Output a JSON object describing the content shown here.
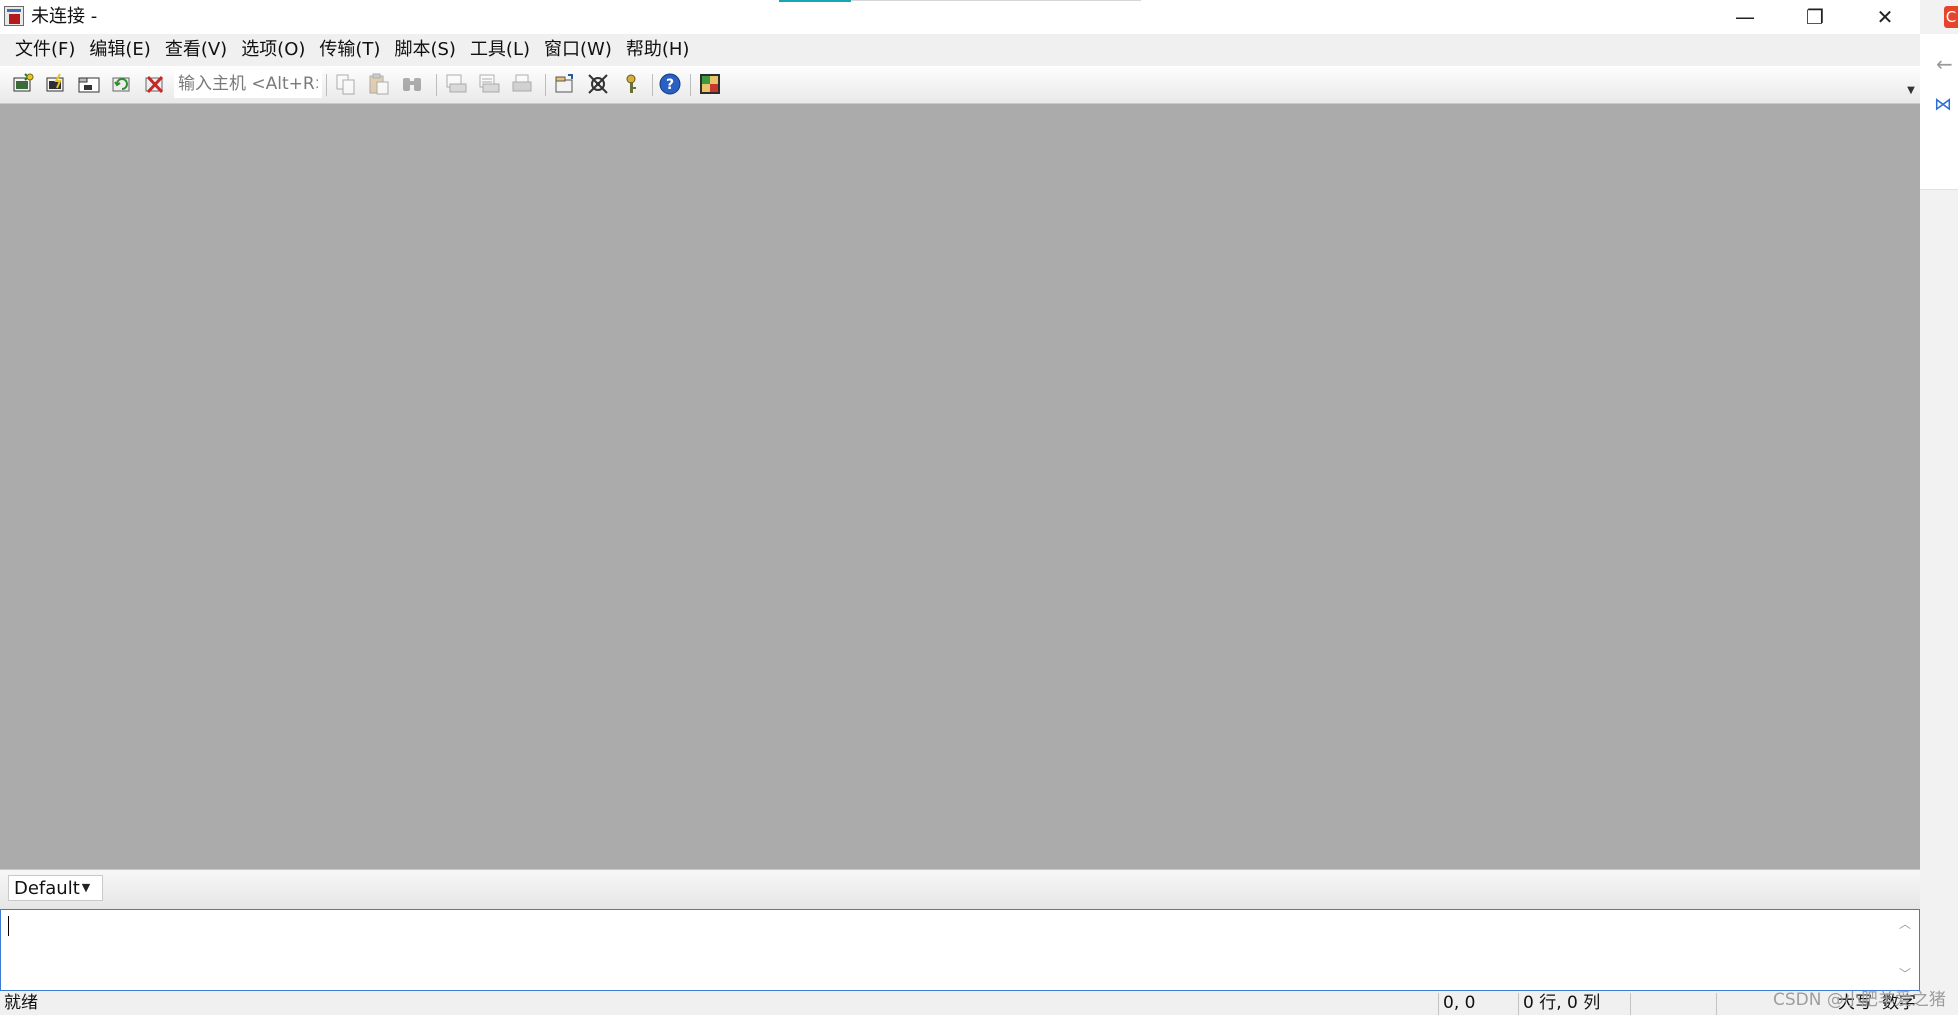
{
  "window": {
    "title": "未连接 -",
    "controls": {
      "minimize": "—",
      "maximize": "❐",
      "close": "✕"
    }
  },
  "menu": [
    "文件(F)",
    "编辑(E)",
    "查看(V)",
    "选项(O)",
    "传输(T)",
    "脚本(S)",
    "工具(L)",
    "窗口(W)",
    "帮助(H)"
  ],
  "toolbar": {
    "host_placeholder": "输入主机 <Alt+R>",
    "icons": {
      "connect": "connect-icon",
      "quick_connect": "quick-connect-icon",
      "connect_in_tab": "connect-in-tab-icon",
      "reconnect": "reconnect-icon",
      "disconnect": "disconnect-icon",
      "copy": "copy-icon",
      "paste": "paste-icon",
      "find": "find-icon",
      "print": "print-icon",
      "print_setup": "print-setup-icon",
      "printer": "printer-icon",
      "session_options": "session-options-icon",
      "global_options": "global-options-icon",
      "keymap": "keymap-icon",
      "help": "help-icon",
      "sftp": "sftp-icon"
    }
  },
  "session_bar": {
    "selected": "Default"
  },
  "statusbar": {
    "status": "就绪",
    "position": "0, 0",
    "rows_cols": "0 行, 0 列",
    "caps": "大写",
    "num": "数字"
  },
  "watermark": "CSDN @小肥羊爱之猪",
  "colors": {
    "terminal_bg": "#ababab",
    "accent": "#16a6b6",
    "input_border": "#3d7bd6"
  }
}
